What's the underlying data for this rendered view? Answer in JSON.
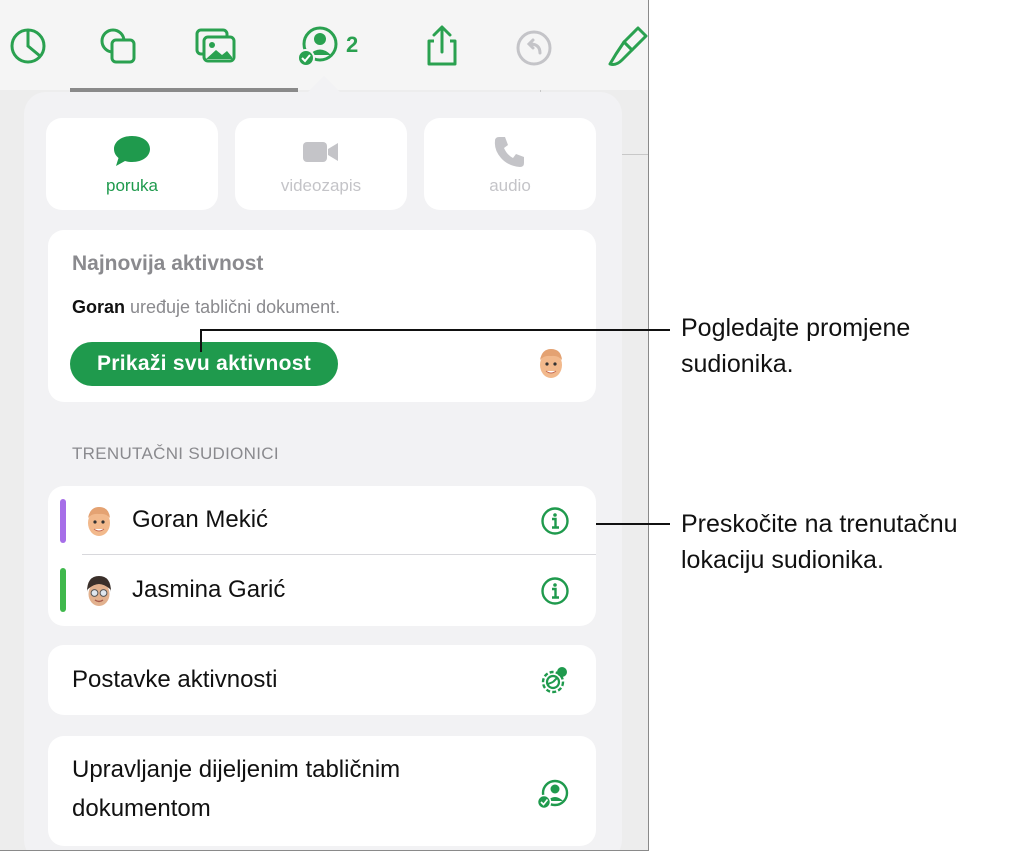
{
  "toolbar": {
    "collab_count": "2",
    "icons": [
      "chart-icon",
      "shapes-icon",
      "media-icon",
      "collaborate-icon",
      "share-icon",
      "undo-icon",
      "format-brush-icon"
    ]
  },
  "communication": {
    "message_label": "poruka",
    "video_label": "videozapis",
    "audio_label": "audio"
  },
  "activity": {
    "title": "Najnovija aktivnost",
    "editor_name": "Goran",
    "editor_action": " uređuje tablični dokument.",
    "show_all_button": "Prikaži svu aktivnost"
  },
  "participants": {
    "section_header": "TRENUTAČNI SUDIONICI",
    "items": [
      {
        "name": "Goran Mekić",
        "color": "#a66ee8"
      },
      {
        "name": "Jasmina Garić",
        "color": "#3fb84c"
      }
    ]
  },
  "settings": {
    "activity_settings_label": "Postavke aktivnosti",
    "manage_label_line1": "Upravljanje dijeljenim tabličnim",
    "manage_label_line2": "dokumentom"
  },
  "callouts": {
    "first_line1": "Pogledajte promjene",
    "first_line2": "sudionika.",
    "second_line1": "Preskočite na trenutačnu",
    "second_line2": "lokaciju sudionika."
  },
  "colors": {
    "accent": "#1f9a4d",
    "icon_green": "#2aa150",
    "disabled_gray": "#c4c4c8",
    "secondary_text": "#8a8a8e"
  }
}
